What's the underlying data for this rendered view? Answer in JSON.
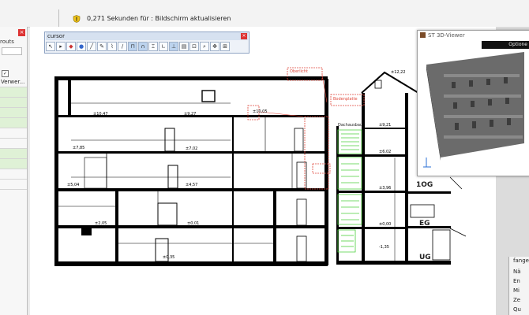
{
  "status_bar": {
    "message": "0,271 Sekunden für : Bildschirm aktualisieren",
    "warning_icon": "warning-shield-icon"
  },
  "left_panel": {
    "close_label": "×",
    "title": "routs",
    "rows": [
      "Verwer...",
      "",
      "",
      "",
      "",
      "",
      "",
      "",
      "",
      "",
      ""
    ]
  },
  "cursor_toolbar": {
    "title": "cursor",
    "close_label": "×",
    "tools": [
      "arrow-icon",
      "select-icon",
      "color-icon",
      "palette-icon",
      "line-icon",
      "pen-icon",
      "brush-icon",
      "pin-icon",
      "snap-icon",
      "magnet-icon",
      "grid-snap-icon",
      "angle-icon",
      "ortho-icon",
      "layer-icon",
      "zoom-window-icon",
      "zoom-icon",
      "pan-icon",
      "zoom-extents-icon"
    ]
  },
  "viewer": {
    "title": "ST 3D-Viewer",
    "options_label": "Optione"
  },
  "drawing": {
    "level_labels": [
      "1OG",
      "EG",
      "UG"
    ],
    "annotations": [
      "Oberlicht",
      "Bodenplatte",
      "Dachausbau"
    ]
  },
  "docker": {
    "title": "fangen",
    "items": [
      "Nä",
      "En",
      "Mi",
      "Ze",
      "Qu"
    ]
  },
  "colors": {
    "accent_red": "#e0483c",
    "stair_green": "#4ccf3c",
    "close_red": "#dd3333"
  }
}
